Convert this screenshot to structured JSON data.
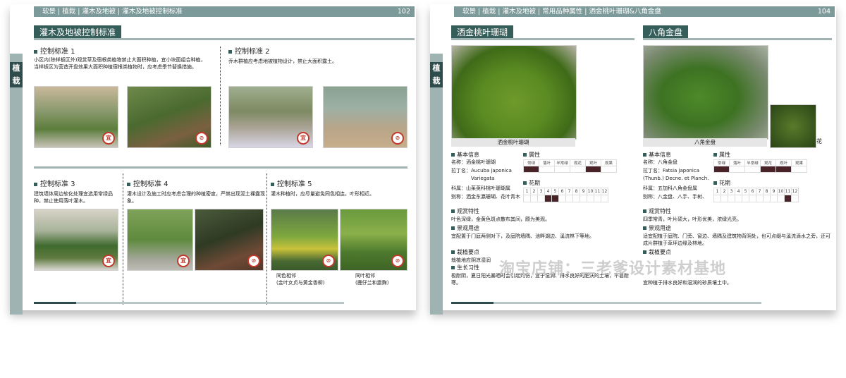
{
  "left_page": {
    "header": {
      "crumbs": "软景 | 植栽 | 灌木及地被 | 灌木及地被控制标准",
      "page_num": "102"
    },
    "side_tab": "植栽",
    "title": "灌木及地被控制标准",
    "std1": {
      "title": "控制标准 1",
      "text": "小区内(除样板区外)观赏草及宿根类植物禁止大面积种植，宜小块面组合种植，当样板区为营造开盘效果大面积种植宿根类植物时，应考虑季节替换措施。",
      "badges": [
        "宜",
        "⊘"
      ]
    },
    "std2": {
      "title": "控制标准 2",
      "text": "乔木群植应考虑地被植物设计，禁止大面积露土。",
      "badges": [
        "宜",
        "⊘"
      ]
    },
    "std3": {
      "title": "控制标准 3",
      "text": "建筑墙体周边软化处理宜选用常绿品种，禁止使用落叶灌木。",
      "badges": [
        "宜"
      ]
    },
    "std4": {
      "title": "控制标准 4",
      "text": "灌木设计及施工时应考虑合理的种植密度，严禁出现泥土裸露现象。",
      "badges": [
        "宜",
        "⊘"
      ]
    },
    "std5": {
      "title": "控制标准 5",
      "text": "灌木种植时，应尽量避免同色相连，叶形相近。",
      "badges": [
        "⊘",
        "⊘"
      ],
      "cap1": "同色相邻\n(金叶女贞与黄金香柳)",
      "cap2": "同叶相邻\n(鹿仔兰和震麴)"
    }
  },
  "right_page": {
    "header": {
      "crumbs": "软景 | 植栽 | 灌木及地被 | 常用品种属性 | 洒金桃叶珊瑚&八角金盘",
      "page_num": "104"
    },
    "side_tab": "植栽",
    "plant1": {
      "title": "洒金桃叶珊瑚",
      "photo_caption": "洒金桃叶珊瑚",
      "basic_title": "基本信息",
      "name": "名称：洒金桃叶珊瑚",
      "latin1": "拉丁名：Aucuba japonica",
      "latin2": "Variegata",
      "family": "科属：山茱萸科桃叶珊瑚属",
      "alias": "别称：洒金东瀛珊瑚、花叶青木",
      "attr_title": "属性",
      "attr_labels": [
        "常绿",
        "落叶",
        "半常绿",
        "观花",
        "观叶",
        "观果"
      ],
      "attr_on": [
        1,
        0,
        0,
        0,
        1,
        0
      ],
      "flower_title": "花期",
      "months": [
        "1",
        "2",
        "3",
        "4",
        "5",
        "6",
        "7",
        "8",
        "9",
        "10",
        "11",
        "12"
      ],
      "month_on": [
        0,
        0,
        0,
        1,
        1,
        0,
        0,
        0,
        0,
        0,
        0,
        0
      ],
      "view_title": "观赏特性",
      "view_text": "叶色深绿，金黄色斑点散布其间，颇为美观。",
      "use_title": "景观用途",
      "use_text": "宜配置于门庭两侧对下，及庭院墙隅、池畔湖边、溪流林下等地。",
      "care_title": "栽植要点",
      "care_text": "栽植地应阴凉湿润",
      "grow_title": "生长习性",
      "grow_text": "极耐阴，夏日阳光暴晒时会引起灼伤，宜于湿润、排水良好的肥沃的土壤，不甚耐寒。"
    },
    "plant2": {
      "title": "八角金盘",
      "photo_caption": "八角金盘",
      "side_caption": "花",
      "basic_title": "基本信息",
      "name": "名称：八角金盘",
      "latin1": "拉丁名：Fatsia japonica",
      "latin2": "(Thunb.) Decne. et Planch.",
      "family": "科属：五加科八角金盘属",
      "alias": "别称：八金盘、八手、手树、",
      "attr_title": "属性",
      "attr_labels": [
        "常绿",
        "落叶",
        "半常绿",
        "观花",
        "观叶",
        "观果"
      ],
      "attr_on": [
        1,
        0,
        0,
        1,
        1,
        0
      ],
      "flower_title": "花期",
      "months": [
        "1",
        "2",
        "3",
        "4",
        "5",
        "6",
        "7",
        "8",
        "9",
        "10",
        "11",
        "12"
      ],
      "month_on": [
        0,
        0,
        0,
        0,
        0,
        0,
        0,
        0,
        0,
        0,
        1,
        0
      ],
      "view_title": "观赏特性",
      "view_text": "四季常青，叶片硕大，叶形优美，浓绿光亮。",
      "use_title": "景观用途",
      "use_text": "适宜配植于庭院、门旁、窗边、墙隅及建筑物背阴处，也可点缀与溪流滴水之旁，还可成片群植于草坪边缘及林地。",
      "care_title": "栽植要点",
      "care_text": "宜种植于排水良好和湿润的砂质壤土中。"
    }
  },
  "watermark": "淘宝店铺：三老爹设计素材基地",
  "colors": {
    "accent_dark": "#355e5a",
    "header_bg": "#7d9a9a",
    "tab_light": "#9fb3b3",
    "cell_on": "#4a2328",
    "badge_red": "#c0392b"
  }
}
